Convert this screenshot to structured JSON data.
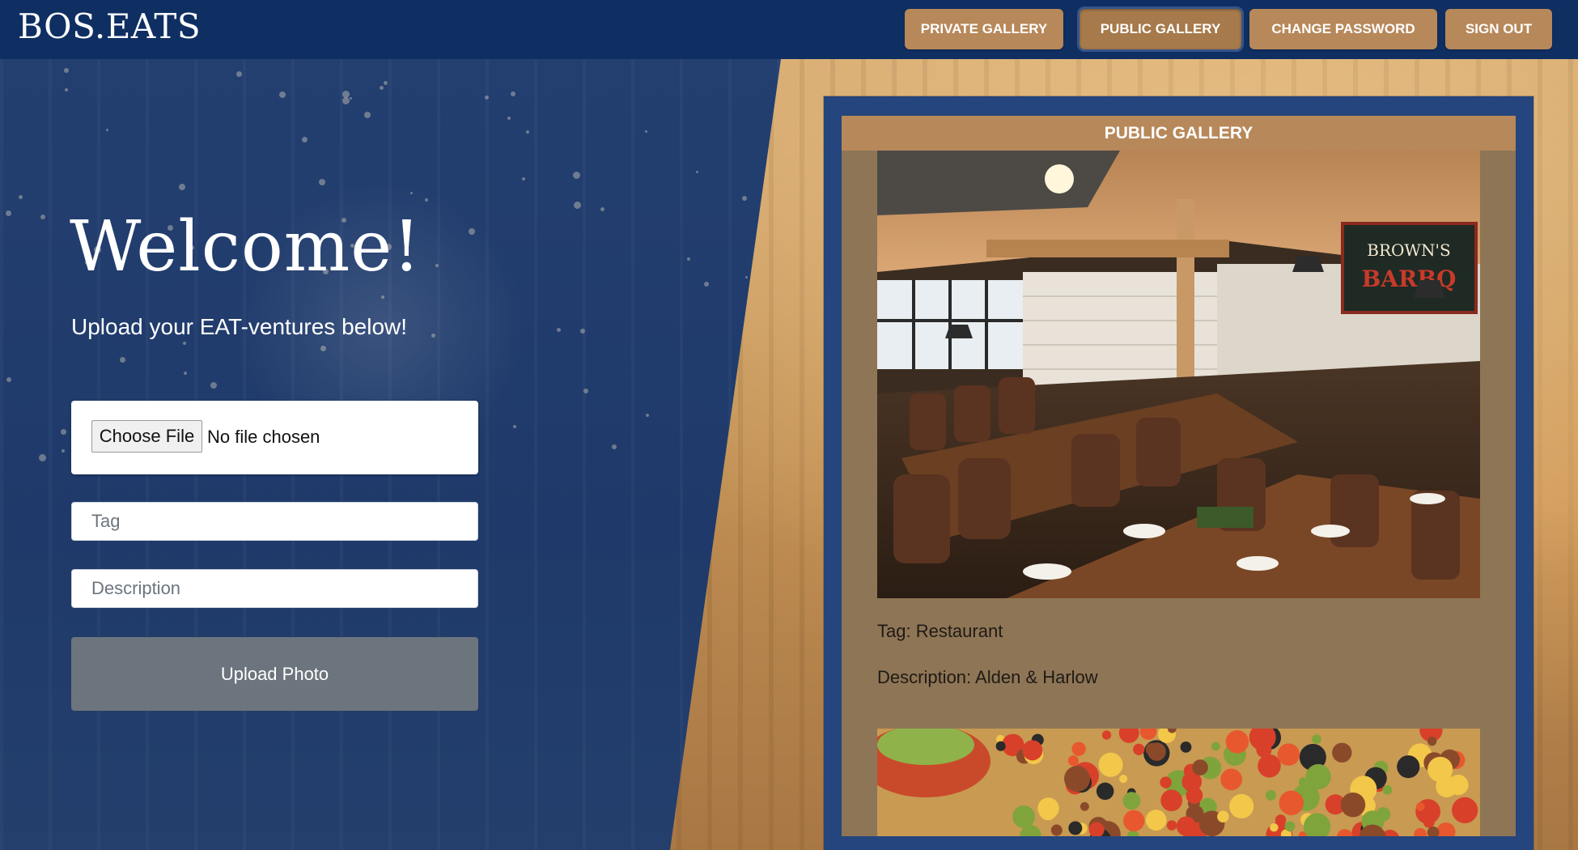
{
  "navbar": {
    "brand": "BOS.EATS",
    "buttons": {
      "private_gallery": "PRIVATE GALLERY",
      "public_gallery": "PUBLIC GALLERY",
      "change_password": "CHANGE PASSWORD",
      "sign_out": "SIGN OUT"
    },
    "active": "public_gallery"
  },
  "hero": {
    "title": "Welcome!",
    "subtitle": "Upload your EAT-ventures below!"
  },
  "upload_form": {
    "file_button": "Choose File",
    "file_status": "No file chosen",
    "tag_placeholder": "Tag",
    "tag_value": "",
    "description_placeholder": "Description",
    "description_value": "",
    "submit_label": "Upload Photo"
  },
  "gallery": {
    "title": "PUBLIC GALLERY",
    "items": [
      {
        "tag": "Tag: Restaurant",
        "description": "Description: Alden & Harlow",
        "photo": "restaurant-interior",
        "sign_text": "BROWN'S BARBQ"
      },
      {
        "photo": "nachos"
      }
    ]
  },
  "colors": {
    "navbar": "#0f2f63",
    "accent": "#b7885a",
    "panel_border": "#24457d",
    "panel_fill": "#8e7556",
    "upload_button": "#6c757d"
  }
}
